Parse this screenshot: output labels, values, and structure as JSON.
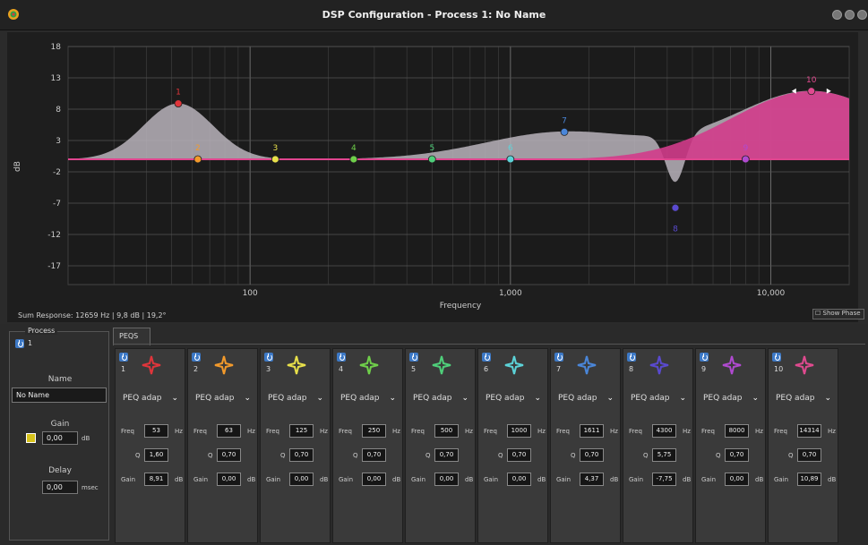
{
  "window": {
    "title": "DSP Configuration  -  Process 1: No Name"
  },
  "graph": {
    "y_ticks": [
      "18",
      "13",
      "8",
      "3",
      "-2",
      "-7",
      "-12",
      "-17"
    ],
    "y_label": "dB",
    "x_ticks": [
      "100",
      "1,000",
      "10,000"
    ],
    "x_label": "Frequency",
    "sum_response": "Sum Response: 12659 Hz | 9,8 dB | 19,2°",
    "show_phase": "Show Phase",
    "colors": {
      "sum_fill": "#b9b3bb",
      "pink": "#e0458f",
      "pink_fill": "#d23c8b"
    }
  },
  "process": {
    "legend": "Process",
    "number": "1",
    "name_label": "Name",
    "name_value": "No Name",
    "gain_label": "Gain",
    "gain_value": "0,00",
    "gain_unit": "dB",
    "delay_label": "Delay",
    "delay_value": "0,00",
    "delay_unit": "msec"
  },
  "tabs": [
    {
      "label": "PEQS"
    }
  ],
  "bands": [
    {
      "num": "1",
      "color": "#e0353b",
      "type": "PEQ adap",
      "freq": "53",
      "q": "1,60",
      "gain": "8,91",
      "fl": "Freq",
      "ql": "Q",
      "gl": "Gain",
      "fu": "Hz",
      "gu": "dB"
    },
    {
      "num": "2",
      "color": "#f39a2b",
      "type": "PEQ adap",
      "freq": "63",
      "q": "0,70",
      "gain": "0,00",
      "fl": "Freq",
      "ql": "Q",
      "gl": "Gain",
      "fu": "Hz",
      "gu": "dB"
    },
    {
      "num": "3",
      "color": "#e8e04a",
      "type": "PEQ adap",
      "freq": "125",
      "q": "0,70",
      "gain": "0,00",
      "fl": "Freq",
      "ql": "Q",
      "gl": "Gain",
      "fu": "Hz",
      "gu": "dB"
    },
    {
      "num": "4",
      "color": "#6fcf4a",
      "type": "PEQ adap",
      "freq": "250",
      "q": "0,70",
      "gain": "0,00",
      "fl": "Freq",
      "ql": "Q",
      "gl": "Gain",
      "fu": "Hz",
      "gu": "dB"
    },
    {
      "num": "5",
      "color": "#4fcf7a",
      "type": "PEQ adap",
      "freq": "500",
      "q": "0,70",
      "gain": "0,00",
      "fl": "Freq",
      "ql": "Q",
      "gl": "Gain",
      "fu": "Hz",
      "gu": "dB"
    },
    {
      "num": "6",
      "color": "#5cd3d8",
      "type": "PEQ adap",
      "freq": "1000",
      "q": "0,70",
      "gain": "0,00",
      "fl": "Freq",
      "ql": "Q",
      "gl": "Gain",
      "fu": "Hz",
      "gu": "dB"
    },
    {
      "num": "7",
      "color": "#4a86d9",
      "type": "PEQ adap",
      "freq": "1611",
      "q": "0,70",
      "gain": "4,37",
      "fl": "Freq",
      "ql": "Q",
      "gl": "Gain",
      "fu": "Hz",
      "gu": "dB"
    },
    {
      "num": "8",
      "color": "#5a4ad0",
      "type": "PEQ adap",
      "freq": "4300",
      "q": "5,75",
      "gain": "-7,75",
      "fl": "Freq",
      "ql": "Q",
      "gl": "Gain",
      "fu": "Hz",
      "gu": "dB"
    },
    {
      "num": "9",
      "color": "#b04ad0",
      "type": "PEQ adap",
      "freq": "8000",
      "q": "0,70",
      "gain": "0,00",
      "fl": "Freq",
      "ql": "Q",
      "gl": "Gain",
      "fu": "Hz",
      "gu": "dB"
    },
    {
      "num": "10",
      "color": "#e04a8f",
      "type": "PEQ adap",
      "freq": "14314",
      "q": "0,70",
      "gain": "10,89",
      "fl": "Freq",
      "ql": "Q",
      "gl": "Gain",
      "fu": "Hz",
      "gu": "dB"
    }
  ]
}
